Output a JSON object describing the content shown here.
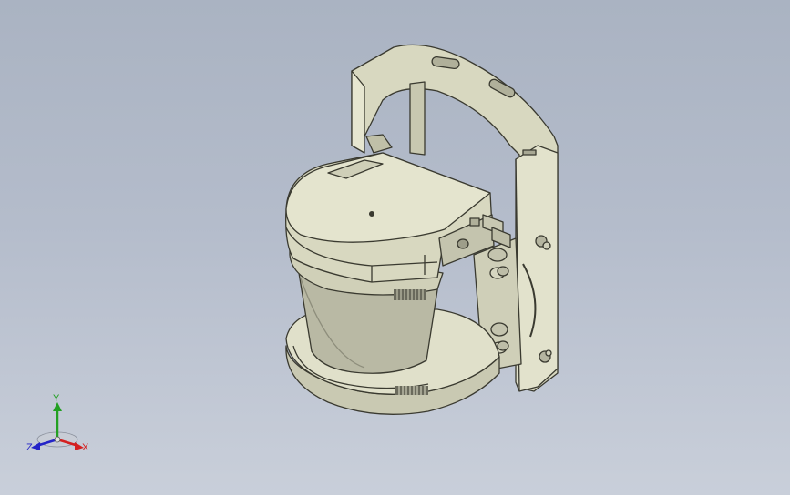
{
  "viewport": {
    "background_top": "#aab3c2",
    "background_bottom": "#c9cfda",
    "model": {
      "icon": "laser-scanner-mount-assembly",
      "body_color": "#d8d8c0",
      "edge_color": "#3a3a30",
      "cup_color": "#b9b9a4"
    }
  },
  "triad": {
    "x_label": "X",
    "y_label": "Y",
    "z_label": "Z",
    "x_color": "#d42020",
    "y_color": "#22a022",
    "z_color": "#2424c8"
  }
}
